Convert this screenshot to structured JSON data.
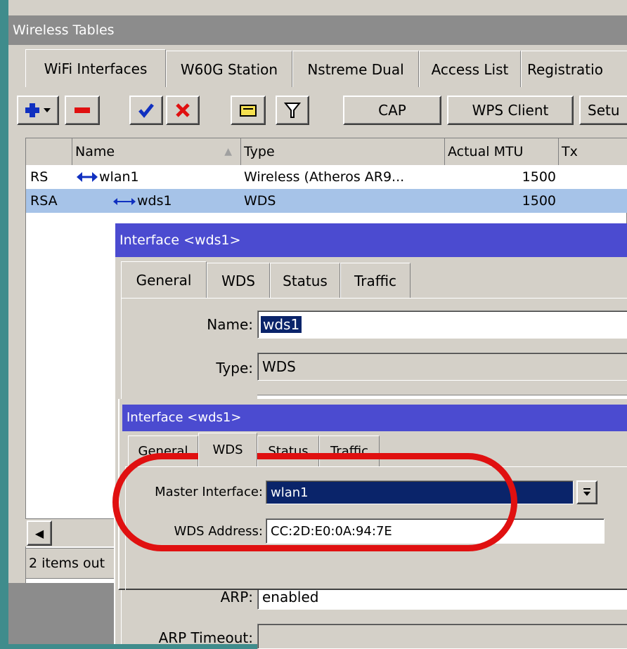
{
  "main_window": {
    "title": "Wireless Tables",
    "tabs": [
      "WiFi Interfaces",
      "W60G Station",
      "Nstreme Dual",
      "Access List",
      "Registratio"
    ],
    "toolbar": {
      "cap_label": "CAP",
      "wps_label": "WPS Client",
      "setup_label": "Setu"
    },
    "columns": {
      "name": "Name",
      "type": "Type",
      "mtu": "Actual MTU",
      "tx": "Tx"
    },
    "rows": [
      {
        "flags": "RS",
        "name": "wlan1",
        "type": "Wireless (Atheros AR9...",
        "mtu": "1500"
      },
      {
        "flags": "RSA",
        "name": "wds1",
        "type": "WDS",
        "mtu": "1500"
      }
    ],
    "status_text": "2 items out"
  },
  "dialog1": {
    "title": "Interface <wds1>",
    "tabs": [
      "General",
      "WDS",
      "Status",
      "Traffic"
    ],
    "name_label": "Name:",
    "name_value": "wds1",
    "type_label": "Type:",
    "type_value": "WDS",
    "arp_label": "ARP:",
    "arp_value": "enabled",
    "arp_timeout_label": "ARP Timeout:"
  },
  "dialog2": {
    "title": "Interface <wds1>",
    "tabs": [
      "General",
      "WDS",
      "Status",
      "Traffic"
    ],
    "master_label": "Master Interface:",
    "master_value": "wlan1",
    "wds_addr_label": "WDS Address:",
    "wds_addr_value": "CC:2D:E0:0A:94:7E"
  },
  "colors": {
    "title_blue": "#4b4bd0",
    "title_gray": "#8c8c8c",
    "highlight_red": "#e01010",
    "selected_row": "#a6c3e8"
  }
}
